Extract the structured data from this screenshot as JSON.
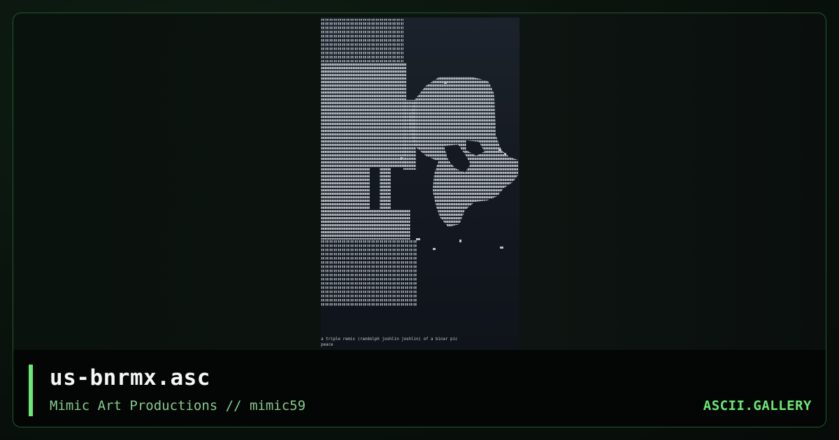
{
  "page": {
    "title": "us-bnrmx.asc",
    "subtitle": "Mimic Art Productions // mimic59",
    "brand": "ASCII.GALLERY"
  },
  "artwork": {
    "caption_line1": "a triple remix (randolph joshlin joshlin) of a binar pic",
    "caption_line2": "peace"
  },
  "colors": {
    "accent": "#6be873",
    "border": "#245a2e",
    "subtitle_text": "#86c98d",
    "background": "#071009",
    "footer_background": "#030604"
  }
}
